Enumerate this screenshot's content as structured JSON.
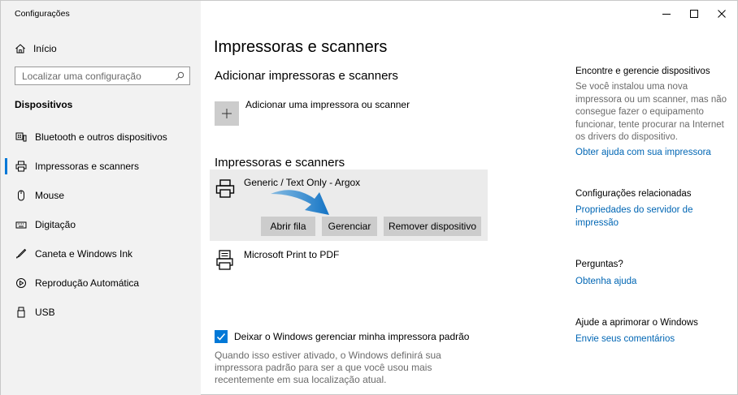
{
  "window": {
    "title": "Configurações",
    "controls": {
      "minimize": "—",
      "maximize": "☐",
      "close": "✕"
    }
  },
  "sidebar": {
    "home_label": "Início",
    "search_placeholder": "Localizar uma configuração",
    "section_title": "Dispositivos",
    "items": [
      {
        "label": "Bluetooth e outros dispositivos",
        "icon": "bluetooth-devices-icon",
        "active": false
      },
      {
        "label": "Impressoras e scanners",
        "icon": "printer-icon",
        "active": true
      },
      {
        "label": "Mouse",
        "icon": "mouse-icon",
        "active": false
      },
      {
        "label": "Digitação",
        "icon": "keyboard-icon",
        "active": false
      },
      {
        "label": "Caneta e Windows Ink",
        "icon": "pen-icon",
        "active": false
      },
      {
        "label": "Reprodução Automática",
        "icon": "autoplay-icon",
        "active": false
      },
      {
        "label": "USB",
        "icon": "usb-icon",
        "active": false
      }
    ]
  },
  "main": {
    "title": "Impressoras e scanners",
    "add_section_title": "Adicionar impressoras e scanners",
    "add_button_label": "Adicionar uma impressora ou scanner",
    "list_title": "Impressoras e scanners",
    "printers": [
      {
        "name": "Generic / Text Only - Argox",
        "selected": true
      },
      {
        "name": "Microsoft Print to PDF",
        "selected": false
      }
    ],
    "actions": {
      "open_queue": "Abrir fila",
      "manage": "Gerenciar",
      "remove": "Remover dispositivo"
    },
    "default_printer": {
      "checked": true,
      "label": "Deixar o Windows gerenciar minha impressora padrão",
      "description": "Quando isso estiver ativado, o Windows definirá sua impressora padrão para ser a que você usou mais recentemente em sua localização atual."
    }
  },
  "right": {
    "find_title": "Encontre e gerencie dispositivos",
    "find_text": "Se você instalou uma nova impressora ou um scanner, mas não consegue fazer o equipamento funcionar, tente procurar na Internet os drivers do dispositivo.",
    "find_link": "Obter ajuda com sua impressora",
    "related_title": "Configurações relacionadas",
    "related_link": "Propriedades do servidor de impressão",
    "questions_title": "Perguntas?",
    "questions_link": "Obtenha ajuda",
    "improve_title": "Ajude a aprimorar o Windows",
    "improve_link": "Envie seus comentários"
  },
  "colors": {
    "accent": "#0078d7",
    "link": "#0066b4",
    "sidebar_bg": "#f2f2f2",
    "selected_bg": "#ebebeb",
    "button_bg": "#cccccc",
    "arrow": "#1e88d6"
  }
}
